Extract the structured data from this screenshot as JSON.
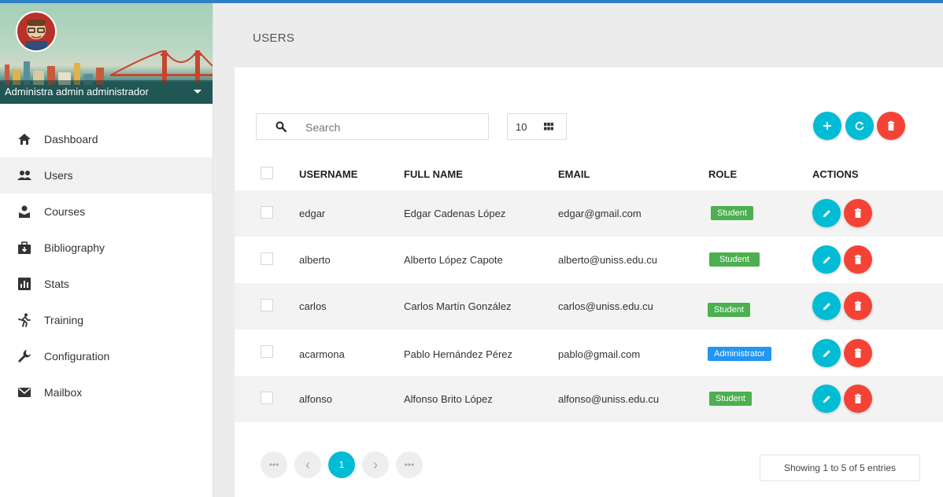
{
  "sidebar": {
    "user_name": "Administra admin administrador",
    "items": [
      {
        "label": "Dashboard"
      },
      {
        "label": "Users"
      },
      {
        "label": "Courses"
      },
      {
        "label": "Bibliography"
      },
      {
        "label": "Stats"
      },
      {
        "label": "Training"
      },
      {
        "label": "Configuration"
      },
      {
        "label": "Mailbox"
      }
    ],
    "active_index": 1
  },
  "page": {
    "title": "USERS"
  },
  "toolbar": {
    "search_placeholder": "Search",
    "per_page": "10"
  },
  "table": {
    "headers": {
      "username": "USERNAME",
      "full_name": "FULL NAME",
      "email": "EMAIL",
      "role": "ROLE",
      "actions": "ACTIONS"
    },
    "rows": [
      {
        "username": "edgar",
        "full_name": "Edgar Cadenas López",
        "email": "edgar@gmail.com",
        "role": "Student"
      },
      {
        "username": "alberto",
        "full_name": "Alberto López Capote",
        "email": "alberto@uniss.edu.cu",
        "role": "Student"
      },
      {
        "username": "carlos",
        "full_name": "Carlos Martín González",
        "email": "carlos@uniss.edu.cu",
        "role": "Student"
      },
      {
        "username": "acarmona",
        "full_name": "Pablo Hernández Pérez",
        "email": "pablo@gmail.com",
        "role": "Administrator"
      },
      {
        "username": "alfonso",
        "full_name": "Alfonso Brito López",
        "email": "alfonso@uniss.edu.cu",
        "role": "Student"
      }
    ]
  },
  "pagination": {
    "first": "•••",
    "prev": "‹",
    "current": "1",
    "next": "›",
    "last": "•••"
  },
  "entries_text": "Showing 1 to 5 of 5 entries",
  "colors": {
    "accent": "#00bcd4",
    "danger": "#f44336",
    "student": "#4caf50",
    "admin": "#2196f3",
    "topbar": "#2f7fc4"
  }
}
